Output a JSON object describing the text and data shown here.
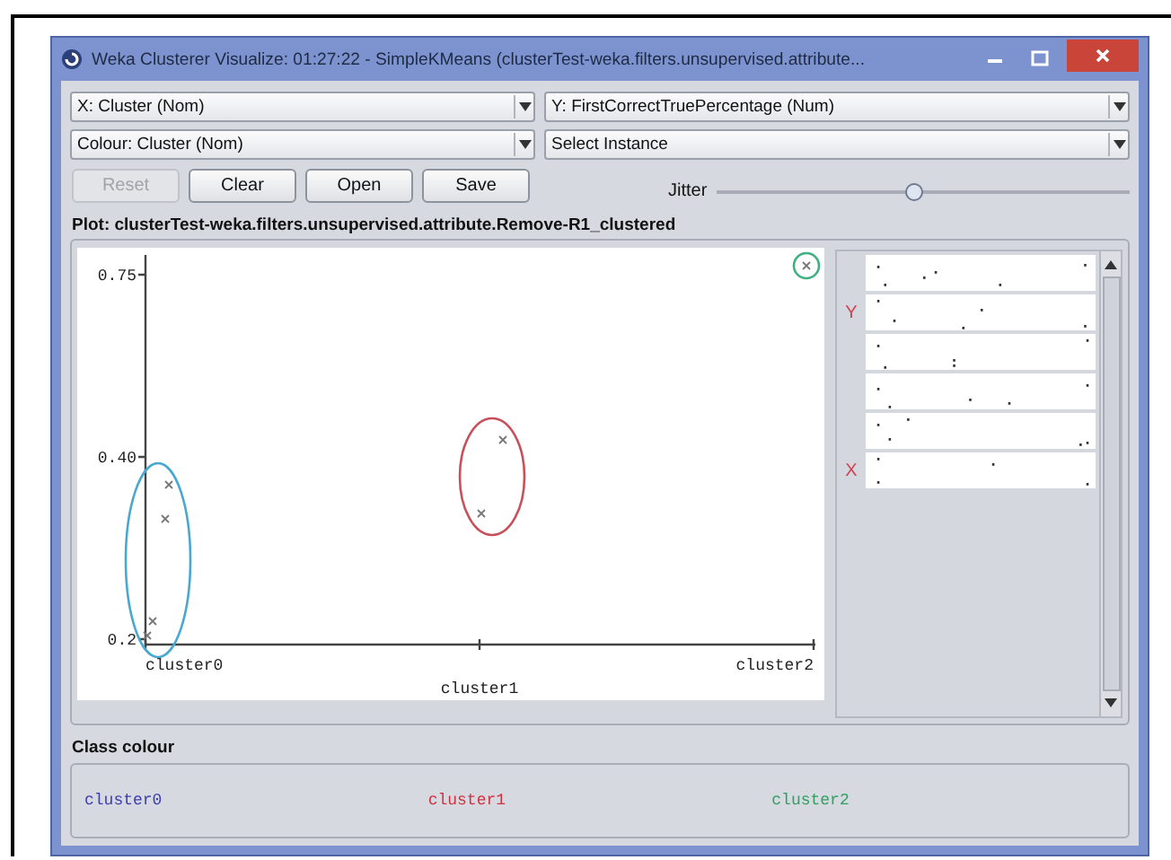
{
  "window": {
    "title": "Weka Clusterer Visualize: 01:27:22 - SimpleKMeans (clusterTest-weka.filters.unsupervised.attribute..."
  },
  "selectors": [
    {
      "value": "X: Cluster (Nom)"
    },
    {
      "value": "Y: FirstCorrectTruePercentage (Num)"
    },
    {
      "value": "Colour: Cluster (Nom)"
    },
    {
      "value": "Select Instance"
    }
  ],
  "buttons": [
    {
      "label": "Reset",
      "disabled": true
    },
    {
      "label": "Clear",
      "disabled": false
    },
    {
      "label": "Open",
      "disabled": false
    },
    {
      "label": "Save",
      "disabled": false
    }
  ],
  "jitter": {
    "label": "Jitter",
    "level": 0.48
  },
  "plot": {
    "title": "Plot: clusterTest-weka.filters.unsupervised.attribute.Remove-R1_clustered",
    "y_axis_labels": [
      "0.75",
      "0.40",
      "0.2"
    ],
    "x_axis_labels": [
      "cluster0",
      "cluster1",
      "cluster2"
    ],
    "clusters": [
      {
        "color": "#48a8d0"
      },
      {
        "color": "#c8505a"
      },
      {
        "color": "#40b080"
      }
    ]
  },
  "attribute_strips": [
    {
      "kind": "plain"
    },
    {
      "kind": "marked",
      "mark": "Y"
    },
    {
      "kind": "plain"
    },
    {
      "kind": "plain"
    },
    {
      "kind": "plain"
    },
    {
      "kind": "marked",
      "mark": "X"
    }
  ],
  "class_colour": {
    "title": "Class colour",
    "items": [
      {
        "label": "cluster0",
        "color": "#3c3cb0"
      },
      {
        "label": "cluster1",
        "color": "#d03040"
      },
      {
        "label": "cluster2",
        "color": "#30a060"
      }
    ]
  }
}
